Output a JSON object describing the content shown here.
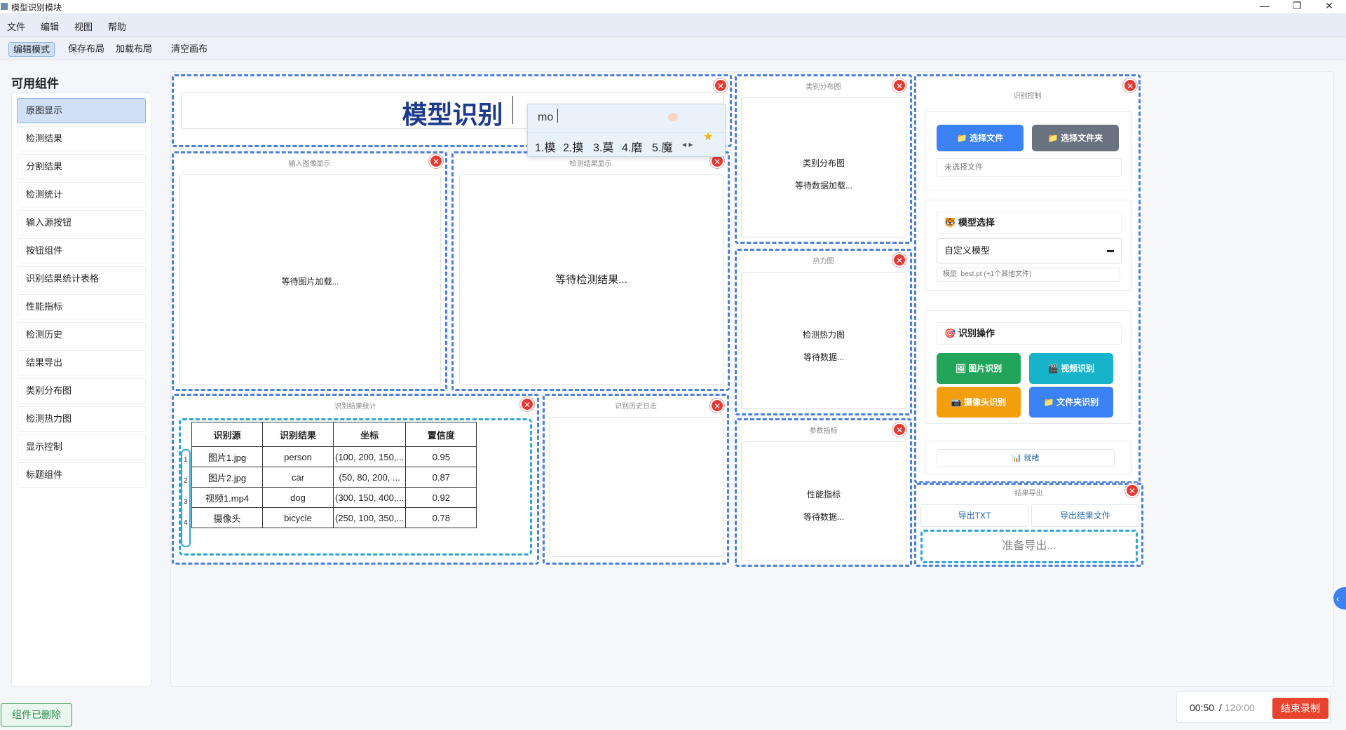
{
  "window": {
    "title": "模型识别模块",
    "minimize": "—",
    "restore": "❐",
    "close": "✕"
  },
  "menu": [
    "文件",
    "编辑",
    "视图",
    "帮助"
  ],
  "toolbar": {
    "edit_mode": "编辑模式",
    "save_layout": "保存布局",
    "load_layout": "加载布局",
    "clear_canvas": "清空画布"
  },
  "sidebar": {
    "title": "可用组件",
    "items": [
      "原图显示",
      "检测结果",
      "分割结果",
      "检测统计",
      "输入源按钮",
      "按钮组件",
      "识别结果统计表格",
      "性能指标",
      "检测历史",
      "结果导出",
      "类别分布图",
      "检测热力图",
      "显示控制",
      "标题组件"
    ]
  },
  "title_comp": {
    "text": "模型识别"
  },
  "ime": {
    "input": "mo",
    "candidates": [
      "1.模",
      "2.摸",
      "3.莫",
      "4.磨",
      "5.魔"
    ]
  },
  "input_image": {
    "title": "输入图像显示",
    "placeholder": "等待图片加载..."
  },
  "detect_result": {
    "title": "检测结果显示",
    "placeholder": "等待检测结果..."
  },
  "class_dist": {
    "title": "类别分布图",
    "line1": "类别分布图",
    "line2": "等待数据加载..."
  },
  "heatmap": {
    "title": "热力图",
    "line1": "检测热力图",
    "line2": "等待数据..."
  },
  "metrics": {
    "title": "参数指标",
    "line1": "性能指标",
    "line2": "等待数据..."
  },
  "stats_table": {
    "title": "识别结果统计",
    "headers": [
      "识别源",
      "识别结果",
      "坐标",
      "置信度"
    ],
    "rows": [
      [
        "图片1.jpg",
        "person",
        "(100, 200, 150,...",
        "0.95"
      ],
      [
        "图片2.jpg",
        "car",
        "(50, 80, 200, ...",
        "0.87"
      ],
      [
        "视频1.mp4",
        "dog",
        "(300, 150, 400,...",
        "0.92"
      ],
      [
        "摄像头",
        "bicycle",
        "(250, 100, 350,...",
        "0.78"
      ]
    ],
    "row_numbers": [
      "1",
      "2",
      "3",
      "4"
    ]
  },
  "history": {
    "title": "识别历史日志"
  },
  "control": {
    "title": "识别控制",
    "select_file": "选择文件",
    "select_folder": "选择文件夹",
    "file_status": "未选择文件",
    "model_section": "模型选择",
    "model_value": "自定义模型",
    "model_hint": "模型: best.pt (+1个其他文件)",
    "ops_section": "识别操作",
    "image_recog": "图片识别",
    "video_recog": "视频识别",
    "camera_recog": "摄像头识别",
    "folder_recog": "文件夹识别",
    "status": "就绪"
  },
  "export": {
    "title": "结果导出",
    "txt": "导出TXT",
    "file": "导出结果文件",
    "status": "准备导出..."
  },
  "footer": {
    "deleted_msg": "组件已删除",
    "time_current": "00:50",
    "time_sep": " / ",
    "time_total": "120:00",
    "stop_rec": "结束录制"
  },
  "colors": {
    "accent": "#4a7fe0",
    "blue_btn": "#3b82f6",
    "gray_btn": "#6b7280",
    "green_btn": "#22a55a",
    "cyan_btn": "#17b3c8",
    "orange_btn": "#f59e0b",
    "close_red": "#e53935"
  }
}
